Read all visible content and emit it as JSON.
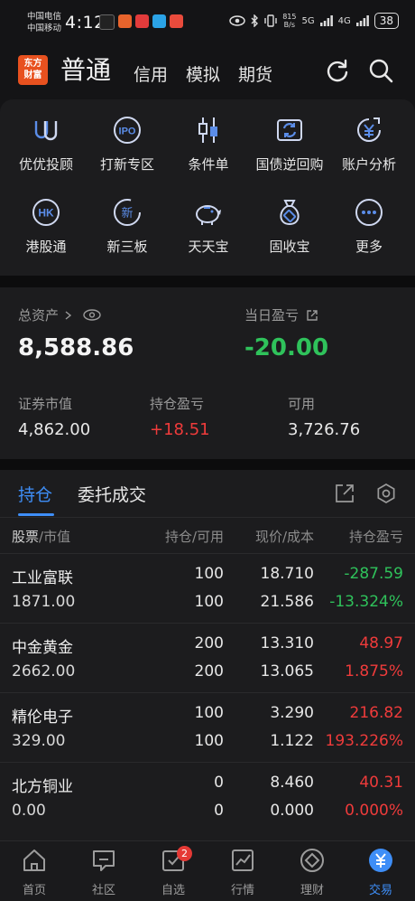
{
  "status_bar": {
    "carrier1": "中国电信",
    "carrier2": "中国移动",
    "time": "4:12",
    "net_speed_value": "815",
    "net_speed_unit": "B/s",
    "signal1": "5G",
    "signal2": "4G",
    "battery": "38"
  },
  "header": {
    "logo_line1": "东方",
    "logo_line2": "财富",
    "active_mode": "普通",
    "modes": [
      "信用",
      "模拟",
      "期货"
    ]
  },
  "menu": {
    "items": [
      {
        "label": "优优投顾",
        "icon": "uu-advisor-icon"
      },
      {
        "label": "打新专区",
        "icon": "ipo-icon",
        "icon_text": "IPO"
      },
      {
        "label": "条件单",
        "icon": "candlestick-icon"
      },
      {
        "label": "国债逆回购",
        "icon": "repo-icon"
      },
      {
        "label": "账户分析",
        "icon": "yen-analysis-icon"
      },
      {
        "label": "港股通",
        "icon": "hk-icon",
        "icon_text": "HK"
      },
      {
        "label": "新三板",
        "icon": "new-board-icon",
        "icon_text": "新"
      },
      {
        "label": "天天宝",
        "icon": "piggy-bank-icon"
      },
      {
        "label": "固收宝",
        "icon": "money-bag-icon"
      },
      {
        "label": "更多",
        "icon": "more-icon"
      }
    ]
  },
  "assets": {
    "total_label": "总资产",
    "total_value": "8,588.86",
    "daily_pl_label": "当日盈亏",
    "daily_pl_value": "-20.00",
    "market_value_label": "证券市值",
    "market_value": "4,862.00",
    "holding_pl_label": "持仓盈亏",
    "holding_pl": "+18.51",
    "available_label": "可用",
    "available": "3,726.76"
  },
  "positions": {
    "tab_active": "持仓",
    "tab_other": "委托成交",
    "headers": {
      "stock": "股票",
      "market_value": "/市值",
      "qty": "持仓/可用",
      "price": "现价/成本",
      "pl": "持仓盈亏"
    },
    "rows": [
      {
        "name": "工业富联",
        "market_value": "1871.00",
        "qty": "100",
        "avail": "100",
        "price": "18.710",
        "cost": "21.586",
        "pl": "-287.59",
        "pl_pct": "-13.324%",
        "dir": "down"
      },
      {
        "name": "中金黄金",
        "market_value": "2662.00",
        "qty": "200",
        "avail": "200",
        "price": "13.310",
        "cost": "13.065",
        "pl": "48.97",
        "pl_pct": "1.875%",
        "dir": "up"
      },
      {
        "name": "精伦电子",
        "market_value": "329.00",
        "qty": "100",
        "avail": "100",
        "price": "3.290",
        "cost": "1.122",
        "pl": "216.82",
        "pl_pct": "193.226%",
        "dir": "up"
      },
      {
        "name": "北方铜业",
        "market_value": "0.00",
        "qty": "0",
        "avail": "0",
        "price": "8.460",
        "cost": "0.000",
        "pl": "40.31",
        "pl_pct": "0.000%",
        "dir": "up"
      }
    ]
  },
  "tabbar": {
    "items": [
      {
        "label": "首页",
        "icon": "home-icon"
      },
      {
        "label": "社区",
        "icon": "community-icon"
      },
      {
        "label": "自选",
        "icon": "watchlist-icon",
        "badge": "2"
      },
      {
        "label": "行情",
        "icon": "market-chart-icon"
      },
      {
        "label": "理财",
        "icon": "wealth-icon"
      },
      {
        "label": "交易",
        "icon": "trade-icon",
        "active": true
      }
    ]
  },
  "colors": {
    "accent": "#3e8ef7",
    "gain": "#ef3b3b",
    "loss": "#2fc25b",
    "logo": "#e8511f"
  }
}
